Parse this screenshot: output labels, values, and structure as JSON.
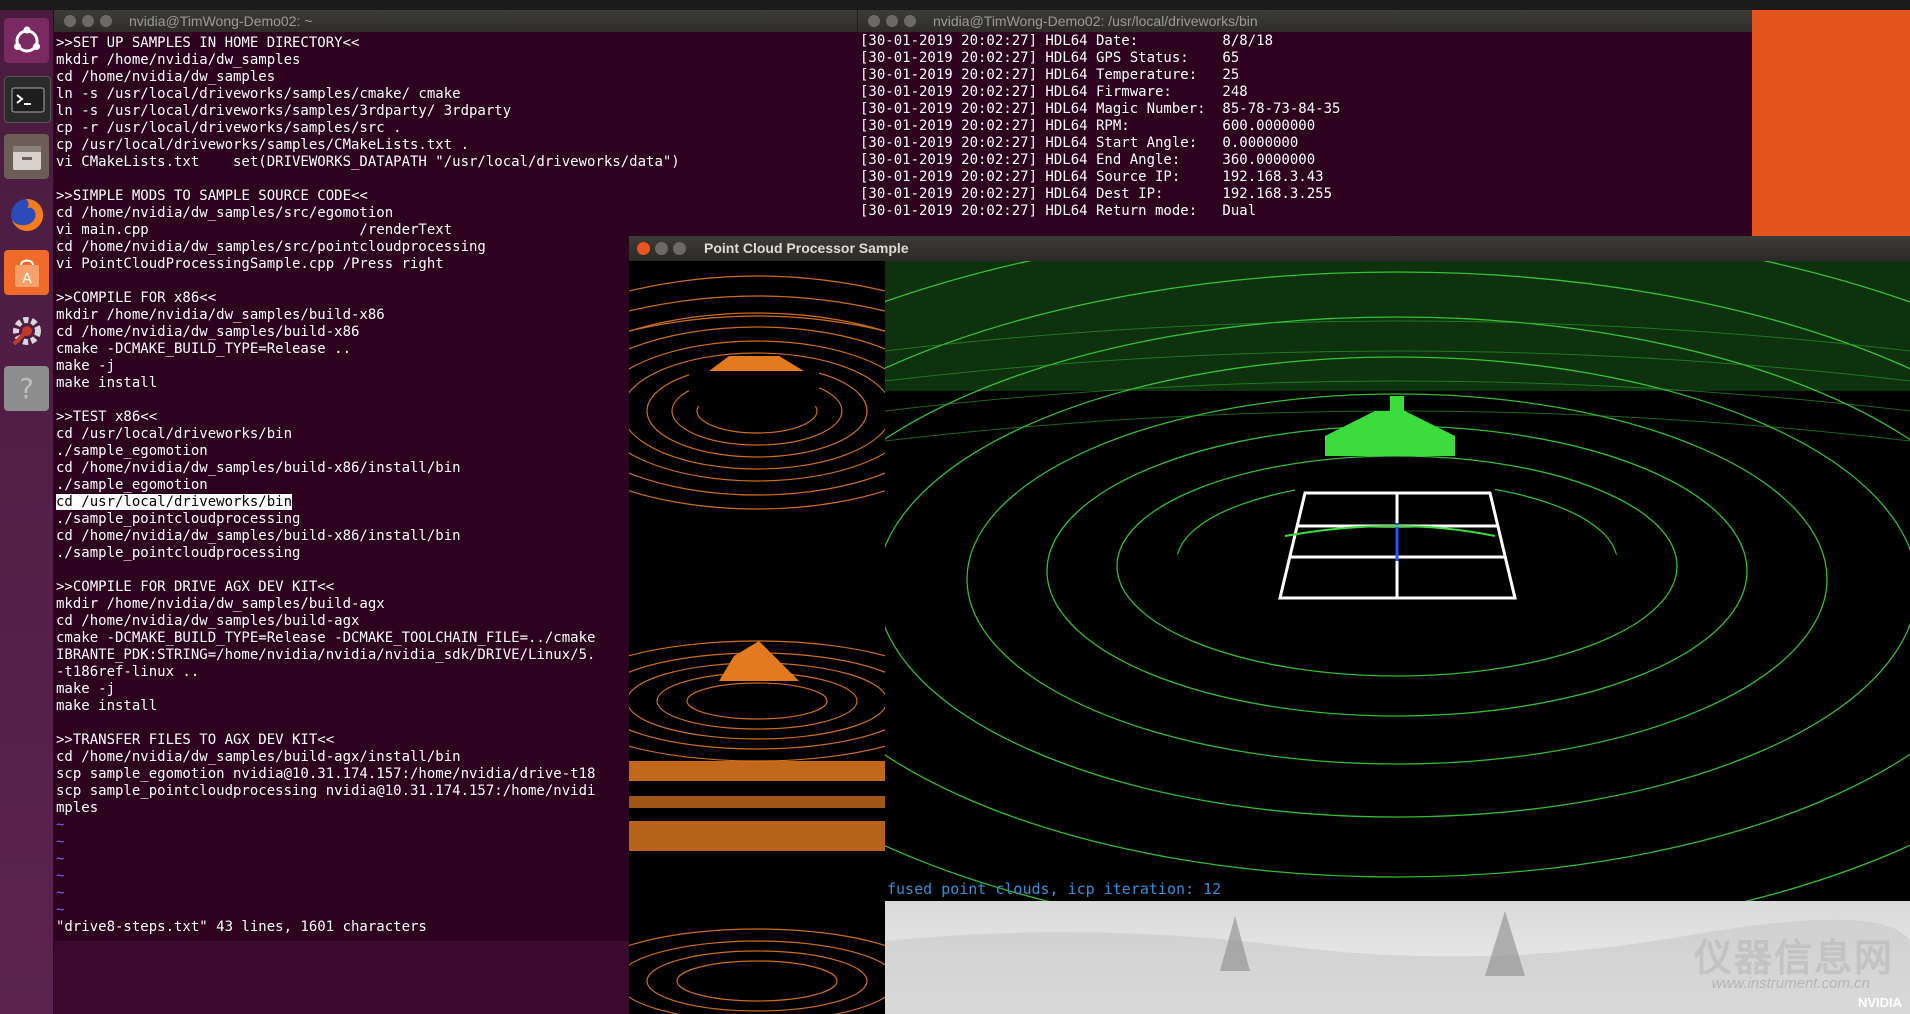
{
  "windows": {
    "left_terminal_title": "nvidia@TimWong-Demo02: ~",
    "right_terminal_title": "nvidia@TimWong-Demo02: /usr/local/driveworks/bin",
    "viewer_title": "Point Cloud Processor Sample"
  },
  "launcher": {
    "icons": [
      "ubuntu-dash-icon",
      "terminal-icon",
      "files-icon",
      "firefox-icon",
      "software-center-icon",
      "settings-icon",
      "help-icon"
    ]
  },
  "editor": {
    "lines": [
      ">>SET UP SAMPLES IN HOME DIRECTORY<<",
      "mkdir /home/nvidia/dw_samples",
      "cd /home/nvidia/dw_samples",
      "ln -s /usr/local/driveworks/samples/cmake/ cmake",
      "ln -s /usr/local/driveworks/samples/3rdparty/ 3rdparty",
      "cp -r /usr/local/driveworks/samples/src .",
      "cp /usr/local/driveworks/samples/CMakeLists.txt .",
      "vi CMakeLists.txt    set(DRIVEWORKS_DATAPATH \"/usr/local/driveworks/data\")",
      "",
      ">>SIMPLE MODS TO SAMPLE SOURCE CODE<<",
      "cd /home/nvidia/dw_samples/src/egomotion",
      "vi main.cpp                         /renderText",
      "cd /home/nvidia/dw_samples/src/pointcloudprocessing",
      "vi PointCloudProcessingSample.cpp /Press right",
      "",
      ">>COMPILE FOR x86<<",
      "mkdir /home/nvidia/dw_samples/build-x86",
      "cd /home/nvidia/dw_samples/build-x86",
      "cmake -DCMAKE_BUILD_TYPE=Release ..",
      "make -j",
      "make install",
      "",
      ">>TEST x86<<",
      "cd /usr/local/driveworks/bin",
      "./sample_egomotion",
      "cd /home/nvidia/dw_samples/build-x86/install/bin",
      "./sample_egomotion",
      "cd /usr/local/driveworks/bin",
      "./sample_pointcloudprocessing",
      "cd /home/nvidia/dw_samples/build-x86/install/bin",
      "./sample_pointcloudprocessing",
      "",
      ">>COMPILE FOR DRIVE AGX DEV KIT<<",
      "mkdir /home/nvidia/dw_samples/build-agx",
      "cd /home/nvidia/dw_samples/build-agx",
      "cmake -DCMAKE_BUILD_TYPE=Release -DCMAKE_TOOLCHAIN_FILE=../cmake",
      "IBRANTE_PDK:STRING=/home/nvidia/nvidia/nvidia_sdk/DRIVE/Linux/5.",
      "-t186ref-linux ..",
      "make -j",
      "make install",
      "",
      ">>TRANSFER FILES TO AGX DEV KIT<<",
      "cd /home/nvidia/dw_samples/build-agx/install/bin",
      "scp sample_egomotion nvidia@10.31.174.157:/home/nvidia/drive-t18",
      "scp sample_pointcloudprocessing nvidia@10.31.174.157:/home/nvidi",
      "mples"
    ],
    "tildes": [
      "~",
      "~",
      "~",
      "~",
      "~",
      "~"
    ],
    "status": "\"drive8-steps.txt\" 43 lines, 1601 characters"
  },
  "lidar_log": {
    "lines": [
      "[30-01-2019 20:02:27] HDL64 Date:          8/8/18",
      "[30-01-2019 20:02:27] HDL64 GPS Status:    65",
      "[30-01-2019 20:02:27] HDL64 Temperature:   25",
      "[30-01-2019 20:02:27] HDL64 Firmware:      248",
      "[30-01-2019 20:02:27] HDL64 Magic Number:  85-78-73-84-35",
      "[30-01-2019 20:02:27] HDL64 RPM:           600.0000000",
      "[30-01-2019 20:02:27] HDL64 Start Angle:   0.0000000",
      "[30-01-2019 20:02:27] HDL64 End Angle:     360.0000000",
      "[30-01-2019 20:02:27] HDL64 Source IP:     192.168.3.43",
      "[30-01-2019 20:02:27] HDL64 Dest IP:       192.168.3.255",
      "[30-01-2019 20:02:27] HDL64 Return mode:   Dual"
    ]
  },
  "viewer": {
    "caption": "fused point clouds, icp iteration: 12"
  },
  "watermark": {
    "text": "仪器信息网",
    "url": "www.instrument.com.cn",
    "brand": "NVIDIA"
  },
  "colors": {
    "terminal_bg": "#2c001e",
    "lidar_green": "#3ddc3d",
    "lidar_orange": "#e37a1f",
    "caption_blue": "#2f8fd8",
    "highlight_bg": "#ffffff"
  }
}
